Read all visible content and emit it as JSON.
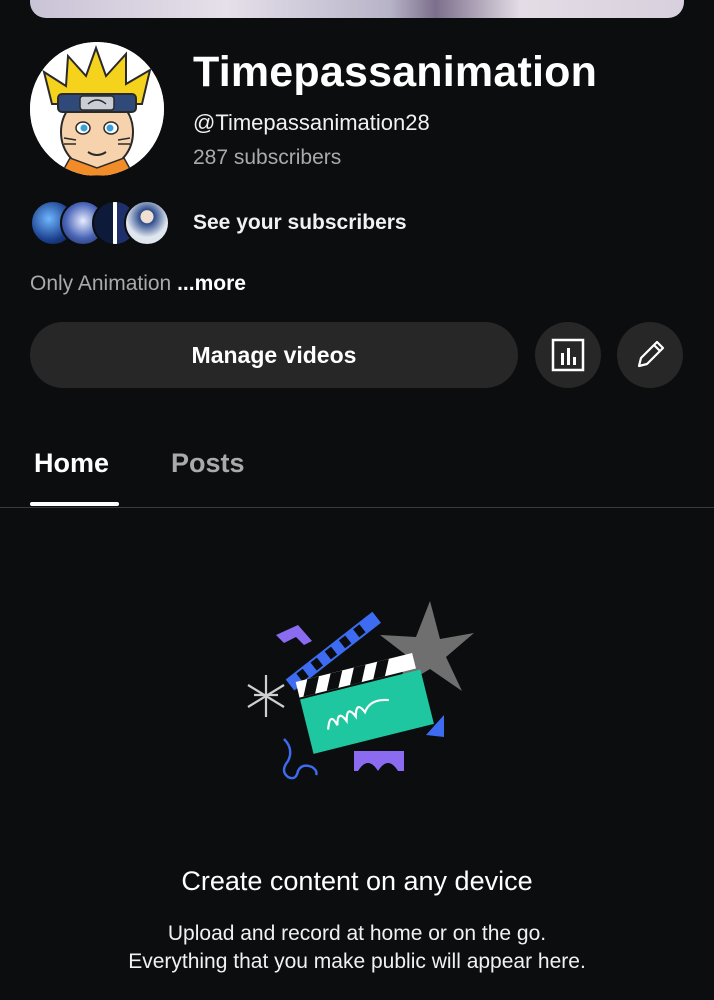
{
  "channel": {
    "name": "Timepassanimation",
    "handle": "@Timepassanimation28",
    "subscribers": "287 subscribers",
    "see_subscribers": "See your subscribers",
    "description": "Only Animation",
    "more_label": "...more"
  },
  "actions": {
    "manage_videos": "Manage videos",
    "analytics_icon": "analytics-icon",
    "edit_icon": "pencil-icon"
  },
  "tabs": [
    {
      "label": "Home",
      "selected": true
    },
    {
      "label": "Posts",
      "selected": false
    }
  ],
  "empty_state": {
    "title": "Create content on any device",
    "line1": "Upload and record at home or on the go.",
    "line2": "Everything that you make public will appear here."
  },
  "colors": {
    "background": "#0b0d0e",
    "button": "#272727",
    "secondary_text": "#aaaaaa"
  }
}
